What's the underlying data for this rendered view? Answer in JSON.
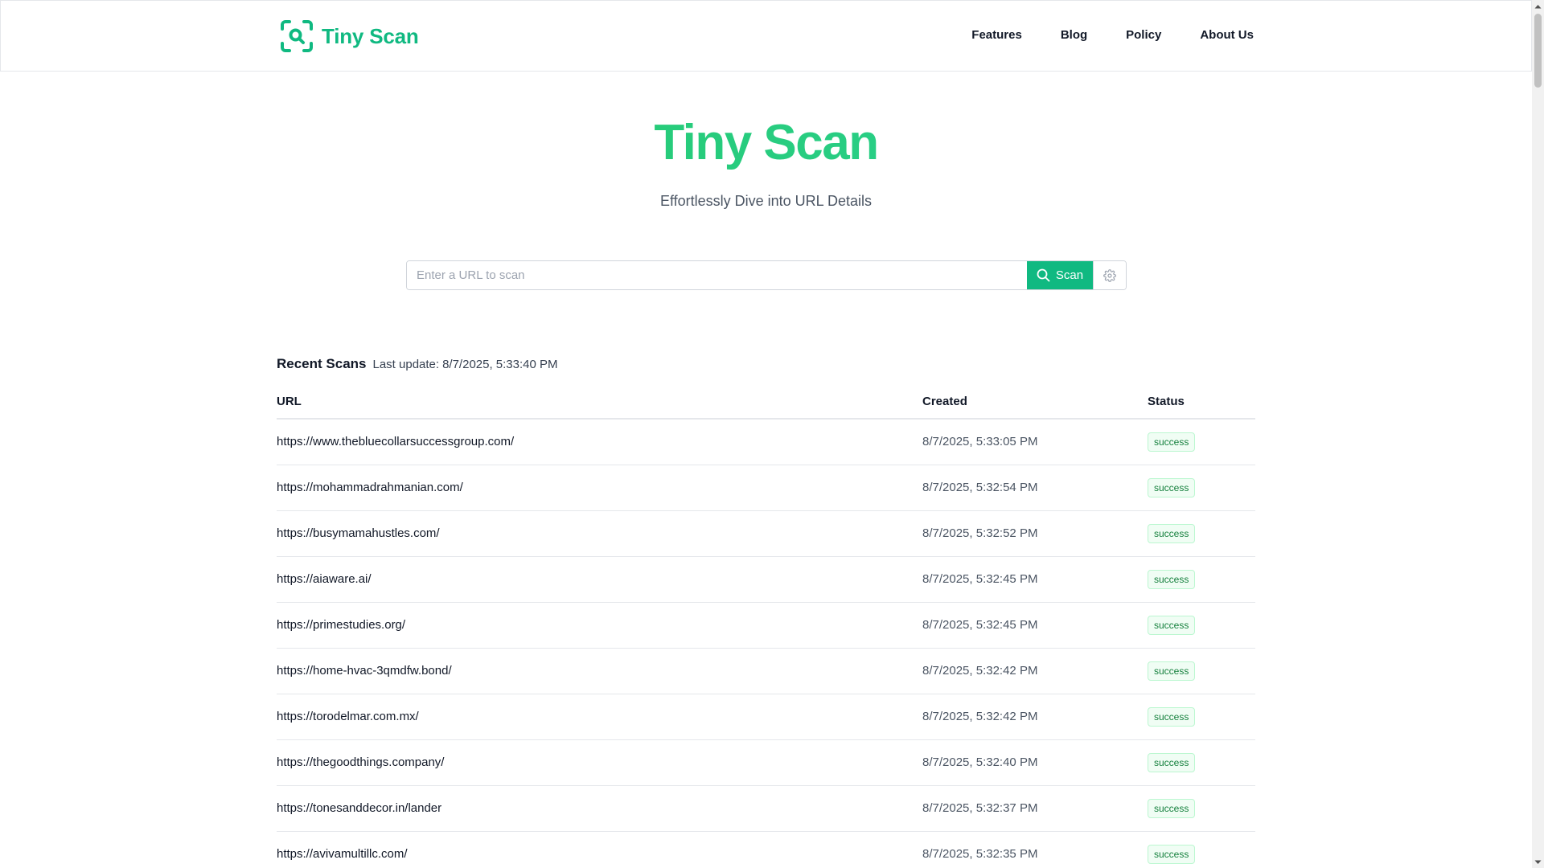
{
  "brand": {
    "name": "Tiny Scan",
    "icon": "scan-search-icon",
    "color": "#10b981"
  },
  "nav": [
    {
      "label": "Features"
    },
    {
      "label": "Blog"
    },
    {
      "label": "Policy"
    },
    {
      "label": "About Us"
    }
  ],
  "hero": {
    "title": "Tiny Scan",
    "subtitle": "Effortlessly Dive into URL Details"
  },
  "search": {
    "placeholder": "Enter a URL to scan",
    "value": "",
    "button_label": "Scan",
    "button_icon": "search-icon",
    "settings_icon": "gear-icon"
  },
  "recent": {
    "title": "Recent Scans",
    "last_update_label": "Last update:",
    "last_update_value": "8/7/2025, 5:33:40 PM",
    "columns": {
      "url": "URL",
      "created": "Created",
      "status": "Status"
    },
    "rows": [
      {
        "url": "https://www.thebluecollarsuccessgroup.com/",
        "created": "8/7/2025, 5:33:05 PM",
        "status": "success"
      },
      {
        "url": "https://mohammadrahmanian.com/",
        "created": "8/7/2025, 5:32:54 PM",
        "status": "success"
      },
      {
        "url": "https://busymamahustles.com/",
        "created": "8/7/2025, 5:32:52 PM",
        "status": "success"
      },
      {
        "url": "https://aiaware.ai/",
        "created": "8/7/2025, 5:32:45 PM",
        "status": "success"
      },
      {
        "url": "https://primestudies.org/",
        "created": "8/7/2025, 5:32:45 PM",
        "status": "success"
      },
      {
        "url": "https://home-hvac-3qmdfw.bond/",
        "created": "8/7/2025, 5:32:42 PM",
        "status": "success"
      },
      {
        "url": "https://torodelmar.com.mx/",
        "created": "8/7/2025, 5:32:42 PM",
        "status": "success"
      },
      {
        "url": "https://thegoodthings.company/",
        "created": "8/7/2025, 5:32:40 PM",
        "status": "success"
      },
      {
        "url": "https://tonesanddecor.in/lander",
        "created": "8/7/2025, 5:32:37 PM",
        "status": "success"
      },
      {
        "url": "https://avivamultillc.com/",
        "created": "8/7/2025, 5:32:35 PM",
        "status": "success"
      }
    ]
  },
  "colors": {
    "accent": "#10b981",
    "status_success_text": "#15803d",
    "status_success_bg": "#f0fdf4"
  }
}
